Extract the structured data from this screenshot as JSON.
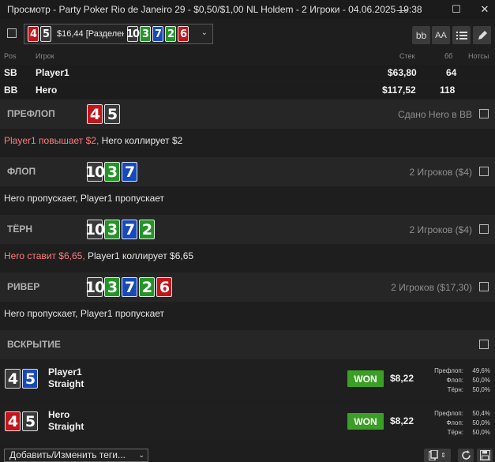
{
  "window": {
    "title": "Просмотр - Party Poker Rio de Janeiro 29 - $0,50/$1,00 NL Holdem - 2 Игроки - 04.06.2025 19:38",
    "minimize_glyph": "—",
    "maximize_glyph": "☐",
    "close_glyph": "✕"
  },
  "toolbar": {
    "hand_summary": "$16,44 [Разделен",
    "hero_cards": [
      "4",
      "5"
    ],
    "board_cards": [
      "10",
      "3",
      "7",
      "2",
      "6"
    ],
    "bb_label": "bb",
    "font_label": "AA"
  },
  "players_header": {
    "pos": "Pos",
    "player": "Игрок",
    "stack": "Стек",
    "bb": "бб",
    "notes": "Нотсы"
  },
  "players": [
    {
      "pos": "SB",
      "name": "Player1",
      "stack": "$63,80",
      "bb": "64"
    },
    {
      "pos": "BB",
      "name": "Hero",
      "stack": "$117,52",
      "bb": "118"
    }
  ],
  "streets": [
    {
      "name": "ПРЕФЛОП",
      "cards": [
        "4",
        "5"
      ],
      "info": "Сдано Hero в BB",
      "actions": [
        {
          "text": "Player1 повышает $2,",
          "hl": true
        },
        {
          "text": " Hero коллирует $2",
          "hl": false
        }
      ]
    },
    {
      "name": "ФЛОП",
      "cards": [
        "10",
        "3",
        "7"
      ],
      "info": "2 Игроков ($4)",
      "actions": [
        {
          "text": "Hero пропускает, Player1 пропускает",
          "hl": false
        }
      ]
    },
    {
      "name": "ТЁРН",
      "cards": [
        "10",
        "3",
        "7",
        "2"
      ],
      "info": "2 Игроков ($4)",
      "actions": [
        {
          "text": "Hero ставит $6,65,",
          "hl": true
        },
        {
          "text": " Player1 коллирует $6,65",
          "hl": false
        }
      ]
    },
    {
      "name": "РИВЕР",
      "cards": [
        "10",
        "3",
        "7",
        "2",
        "6"
      ],
      "info": "2 Игроков ($17,30)",
      "actions": [
        {
          "text": "Hero пропускает, Player1 пропускает",
          "hl": false
        }
      ]
    }
  ],
  "showdown": {
    "title": "ВСКРЫТИЕ",
    "players": [
      {
        "name": "Player1",
        "hand": "Straight",
        "cards": [
          "4",
          "5"
        ],
        "result": "WON",
        "amount": "$8,22",
        "equity": [
          [
            "Префлоп:",
            "49,6%"
          ],
          [
            "Флоп:",
            "50,0%"
          ],
          [
            "Тёрн:",
            "50,0%"
          ]
        ]
      },
      {
        "name": "Hero",
        "hand": "Straight",
        "cards": [
          "4",
          "5"
        ],
        "result": "WON",
        "amount": "$8,22",
        "equity": [
          [
            "Префлоп:",
            "50,4%"
          ],
          [
            "Флоп:",
            "50,0%"
          ],
          [
            "Тёрн:",
            "50,0%"
          ]
        ]
      }
    ]
  },
  "bottom": {
    "tags_label": "Добавить/Изменить теги..."
  },
  "colors": {
    "heart": "#c3141b",
    "club": "#26932a",
    "diamond": "#1849b9",
    "spade": "#3a3a3a",
    "won": "#3b9f26",
    "highlight": "#ff7c7c"
  },
  "icons": [
    "minimize-icon",
    "maximize-icon",
    "close-icon",
    "list-icon",
    "pencil-icon",
    "copy-icon",
    "refresh-icon",
    "save-icon",
    "chevron-down-icon"
  ]
}
